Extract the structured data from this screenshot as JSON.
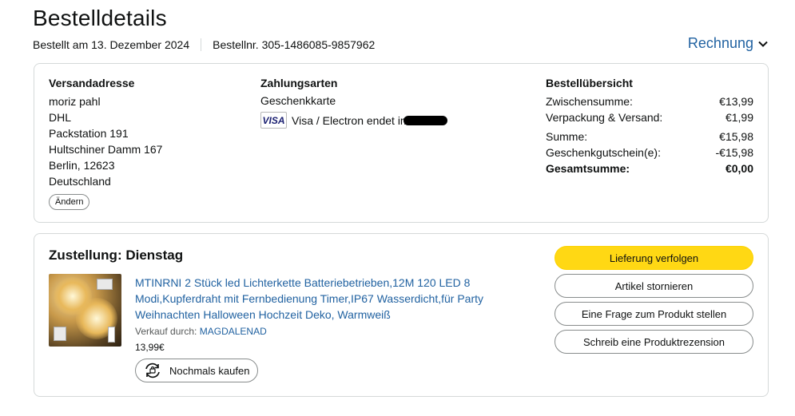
{
  "header": {
    "title": "Bestelldetails",
    "ordered_on": "Bestellt am 13. Dezember 2024",
    "order_number": "Bestellnr. 305-1486085-9857962",
    "invoice_label": "Rechnung"
  },
  "shipping": {
    "heading": "Versandadresse",
    "lines": [
      "moriz pahl",
      "DHL",
      "Packstation 191",
      "Hultschiner Damm 167",
      "Berlin, 12623",
      "Deutschland"
    ],
    "change_label": "Ändern"
  },
  "payment": {
    "heading": "Zahlungsarten",
    "gift_card": "Geschenkkarte",
    "card_brand": "VISA",
    "card_text": "Visa / Electron endet im"
  },
  "summary": {
    "heading": "Bestellübersicht",
    "rows": [
      {
        "label": "Zwischensumme:",
        "value": "€13,99"
      },
      {
        "label": "Verpackung & Versand:",
        "value": "€1,99"
      },
      {
        "label": "Summe:",
        "value": "€15,98"
      },
      {
        "label": "Geschenkgutschein(e):",
        "value": "-€15,98"
      },
      {
        "label": "Gesamtsumme:",
        "value": "€0,00"
      }
    ]
  },
  "delivery": {
    "title": "Zustellung: Dienstag",
    "product_title": "MTINRNI 2 Stück led Lichterkette Batteriebetrieben,12M 120 LED 8 Modi,Kupferdraht mit Fernbedienung Timer,IP67 Wasserdicht,für Party Weihnachten Halloween Hochzeit Deko, Warmweiß",
    "seller_prefix": "Verkauf durch:",
    "seller_name": "MAGDALENAD",
    "price": "13,99€",
    "rebuy_label": "Nochmals kaufen",
    "actions": {
      "track": "Lieferung verfolgen",
      "cancel": "Artikel stornieren",
      "question": "Eine Frage zum Produkt stellen",
      "review": "Schreib eine Produktrezension"
    }
  },
  "colors": {
    "link": "#2162a1",
    "primary_button": "#ffd814",
    "border": "#d5d9d9"
  },
  "icons": {
    "invoice_chevron": "chevron-down-icon",
    "rebuy": "rebuy-cycle-icon",
    "card": "visa-card-icon"
  }
}
